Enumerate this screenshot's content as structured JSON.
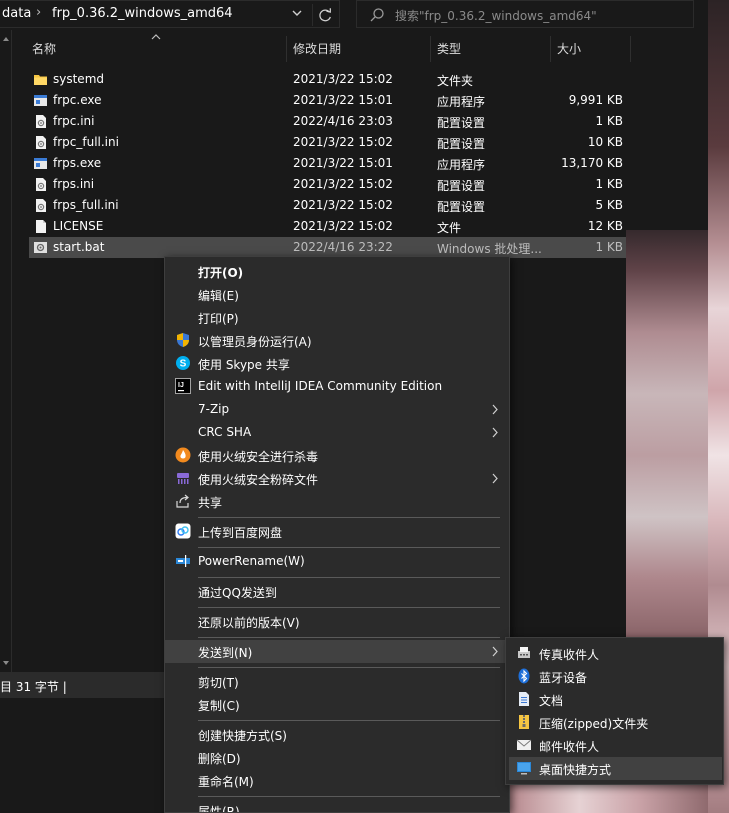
{
  "address": {
    "path_segment_1": "data",
    "path_segment_2": "frp_0.36.2_windows_amd64",
    "separator": "›",
    "search_placeholder": "搜索\"frp_0.36.2_windows_amd64\""
  },
  "columns": {
    "name": "名称",
    "modified": "修改日期",
    "type": "类型",
    "size": "大小"
  },
  "files": [
    {
      "name": "systemd",
      "modified": "2021/3/22 15:02",
      "type": "文件夹",
      "size": "",
      "icon": "folder-icon"
    },
    {
      "name": "frpc.exe",
      "modified": "2021/3/22 15:01",
      "type": "应用程序",
      "size": "9,991 KB",
      "icon": "exe-icon"
    },
    {
      "name": "frpc.ini",
      "modified": "2022/4/16 23:03",
      "type": "配置设置",
      "size": "1 KB",
      "icon": "ini-icon"
    },
    {
      "name": "frpc_full.ini",
      "modified": "2021/3/22 15:02",
      "type": "配置设置",
      "size": "10 KB",
      "icon": "ini-icon"
    },
    {
      "name": "frps.exe",
      "modified": "2021/3/22 15:01",
      "type": "应用程序",
      "size": "13,170 KB",
      "icon": "exe-icon"
    },
    {
      "name": "frps.ini",
      "modified": "2021/3/22 15:02",
      "type": "配置设置",
      "size": "1 KB",
      "icon": "ini-icon"
    },
    {
      "name": "frps_full.ini",
      "modified": "2021/3/22 15:02",
      "type": "配置设置",
      "size": "5 KB",
      "icon": "ini-icon"
    },
    {
      "name": "LICENSE",
      "modified": "2021/3/22 15:02",
      "type": "文件",
      "size": "12 KB",
      "icon": "file-icon"
    },
    {
      "name": "start.bat",
      "modified": "2022/4/16 23:22",
      "type": "Windows 批处理...",
      "size": "1 KB",
      "icon": "bat-icon"
    }
  ],
  "status": {
    "text": "目  31 字节  |"
  },
  "context_menu": {
    "open": "打开(O)",
    "edit": "编辑(E)",
    "print": "打印(P)",
    "run_as_admin": "以管理员身份运行(A)",
    "skype_share": "使用 Skype 共享",
    "intellij": "Edit with IntelliJ IDEA Community Edition",
    "seven_zip": "7-Zip",
    "crc_sha": "CRC SHA",
    "huorong_scan": "使用火绒安全进行杀毒",
    "huorong_shred": "使用火绒安全粉碎文件",
    "share": "共享",
    "baidu_upload": "上传到百度网盘",
    "power_rename": "PowerRename(W)",
    "qq_send": "通过QQ发送到",
    "restore_versions": "还原以前的版本(V)",
    "send_to": "发送到(N)",
    "cut": "剪切(T)",
    "copy": "复制(C)",
    "create_shortcut": "创建快捷方式(S)",
    "delete": "删除(D)",
    "rename": "重命名(M)",
    "properties": "属性(R)"
  },
  "send_to_menu": {
    "fax": "传真收件人",
    "bluetooth": "蓝牙设备",
    "documents": "文档",
    "zip": "压缩(zipped)文件夹",
    "mail": "邮件收件人",
    "desktop": "桌面快捷方式"
  },
  "colors": {
    "background": "#191919",
    "menu_bg": "#2b2b2b",
    "hover": "#414141",
    "selected_row": "#4a4a4a"
  }
}
